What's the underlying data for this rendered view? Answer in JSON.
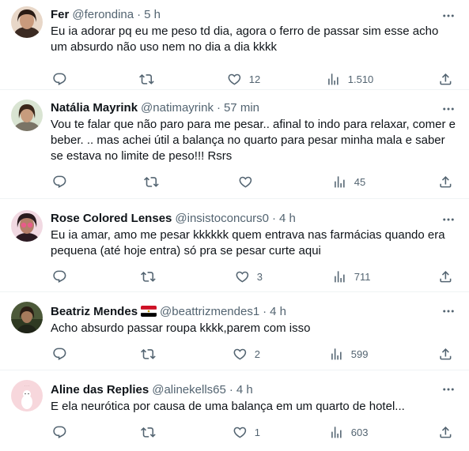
{
  "tweets": [
    {
      "name": "Fer",
      "handle": "@ferondina",
      "time": "5 h",
      "text": "Eu ia adorar pq eu me peso td dia, agora o ferro de passar sim esse acho um absurdo não uso nem no dia a dia kkkk",
      "replies": "",
      "retweets": "",
      "likes": "12",
      "views": "1.510"
    },
    {
      "name": "Natália Mayrink",
      "handle": "@natimayrink",
      "time": "57 min",
      "text": "Vou te falar que não paro para me pesar.. afinal to indo para relaxar, comer e beber. .. mas achei útil a balança no quarto para pesar minha mala e saber se estava no limite de peso!!! Rsrs",
      "replies": "",
      "retweets": "",
      "likes": "",
      "views": "45"
    },
    {
      "name": "Rose Colored Lenses",
      "handle": "@insistoconcurs0",
      "time": "4 h",
      "text": "Eu ia amar, amo me pesar kkkkkk quem entrava nas farmácias quando era pequena (até hoje entra) só pra se pesar curte aqui",
      "replies": "",
      "retweets": "",
      "likes": "3",
      "views": "711"
    },
    {
      "name": "Beatriz Mendes",
      "handle": "@beattrizmendes1",
      "time": "4 h",
      "text": "Acho absurdo passar roupa kkkk,parem com isso",
      "replies": "",
      "retweets": "",
      "likes": "2",
      "views": "599"
    },
    {
      "name": "Aline das Replies",
      "handle": "@alinekells65",
      "time": "4 h",
      "text": "E ela neurótica por causa de uma balança em um quarto de hotel...",
      "replies": "",
      "retweets": "",
      "likes": "1",
      "views": "603"
    }
  ],
  "icons": {
    "more": "more-horizontal-icon",
    "reply": "reply-icon",
    "retweet": "retweet-icon",
    "like": "heart-icon",
    "views": "views-bar-chart-icon",
    "share": "share-icon",
    "flag": "egypt-flag-icon"
  },
  "colors": {
    "text": "#0f1419",
    "secondary": "#536471",
    "divider": "#eff3f4"
  }
}
